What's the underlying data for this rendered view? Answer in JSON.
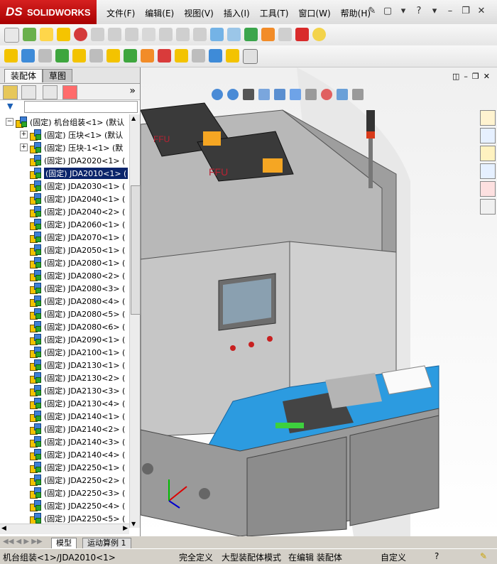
{
  "app": {
    "brand_prefix": "DS",
    "brand_name": "SOLIDWORKS"
  },
  "menu": [
    "文件(F)",
    "编辑(E)",
    "视图(V)",
    "插入(I)",
    "工具(T)",
    "窗口(W)",
    "帮助(H)"
  ],
  "panel_tabs": {
    "active": "装配体",
    "inactive": "草图"
  },
  "tree": {
    "root": "(固定) 机台组装<1> (默认",
    "items": [
      {
        "text": "(固定) 压块<1> (默认",
        "expandable": true
      },
      {
        "text": "(固定) 压块-1<1> (默",
        "expandable": true
      },
      {
        "text": "(固定) JDA2020<1> (",
        "expandable": false
      },
      {
        "text": "(固定) JDA2010<1> (",
        "expandable": false,
        "selected": true
      },
      {
        "text": "(固定) JDA2030<1> (",
        "expandable": false
      },
      {
        "text": "(固定) JDA2040<1> (",
        "expandable": false
      },
      {
        "text": "(固定) JDA2040<2> (",
        "expandable": false
      },
      {
        "text": "(固定) JDA2060<1> (",
        "expandable": false
      },
      {
        "text": "(固定) JDA2070<1> (",
        "expandable": false
      },
      {
        "text": "(固定) JDA2050<1> (",
        "expandable": false
      },
      {
        "text": "(固定) JDA2080<1> (",
        "expandable": false
      },
      {
        "text": "(固定) JDA2080<2> (",
        "expandable": false
      },
      {
        "text": "(固定) JDA2080<3> (",
        "expandable": false
      },
      {
        "text": "(固定) JDA2080<4> (",
        "expandable": false
      },
      {
        "text": "(固定) JDA2080<5> (",
        "expandable": false
      },
      {
        "text": "(固定) JDA2080<6> (",
        "expandable": false
      },
      {
        "text": "(固定) JDA2090<1> (",
        "expandable": false
      },
      {
        "text": "(固定) JDA2100<1> (",
        "expandable": false
      },
      {
        "text": "(固定) JDA2130<1> (",
        "expandable": false
      },
      {
        "text": "(固定) JDA2130<2> (",
        "expandable": false
      },
      {
        "text": "(固定) JDA2130<3> (",
        "expandable": false
      },
      {
        "text": "(固定) JDA2130<4> (",
        "expandable": false
      },
      {
        "text": "(固定) JDA2140<1> (",
        "expandable": false
      },
      {
        "text": "(固定) JDA2140<2> (",
        "expandable": false
      },
      {
        "text": "(固定) JDA2140<3> (",
        "expandable": false
      },
      {
        "text": "(固定) JDA2140<4> (",
        "expandable": false
      },
      {
        "text": "(固定) JDA2250<1> (",
        "expandable": false
      },
      {
        "text": "(固定) JDA2250<2> (",
        "expandable": false
      },
      {
        "text": "(固定) JDA2250<3> (",
        "expandable": false
      },
      {
        "text": "(固定) JDA2250<4> (",
        "expandable": false
      },
      {
        "text": "(固定) JDA2250<5> (",
        "expandable": false
      }
    ]
  },
  "bottom_tabs": [
    "模型",
    "运动算例 1"
  ],
  "status": {
    "path": "机台组装<1>/JDA2010<1>",
    "constraint": "完全定义",
    "mode": "大型装配体模式",
    "editing": "在编辑 装配体",
    "custom": "自定义"
  },
  "colors": {
    "brand_red": "#c81414",
    "selection": "#0a246a",
    "viewport_bg": "#f4f4f4",
    "machine_gray": "#c9c9c9",
    "ffu_dark": "#3a3a3a",
    "ffu_orange": "#f5a623",
    "tray_blue": "#2c9be0"
  }
}
